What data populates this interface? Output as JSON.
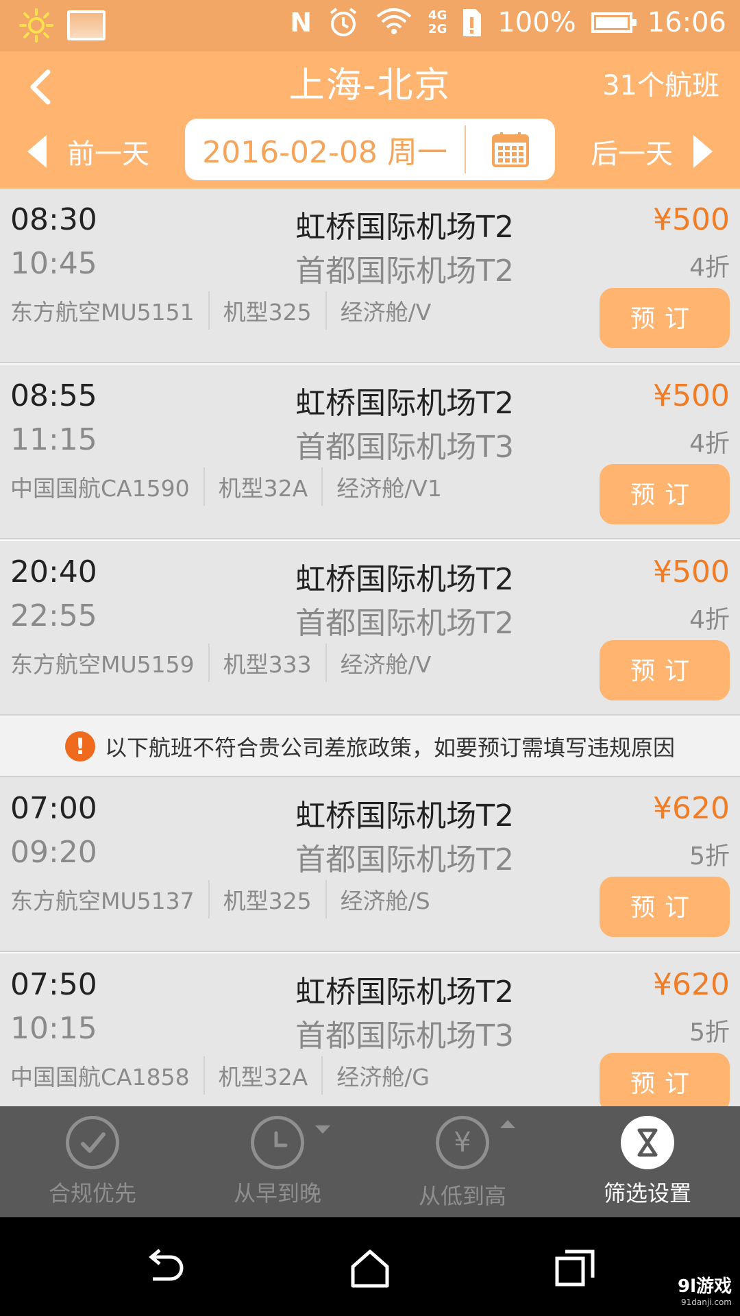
{
  "status_bar": {
    "icons": [
      "sun-icon",
      "image-icon",
      "nfc-icon",
      "alarm-icon",
      "wifi-icon",
      "signal-icon",
      "sim-icon",
      "battery-icon"
    ],
    "network_4g": "4G",
    "network_2g": "2G",
    "battery_percent": "100%",
    "time": "16:06"
  },
  "header": {
    "title": "上海-北京",
    "flight_count": "31个航班",
    "prev_day": "前一天",
    "next_day": "后一天",
    "date": "2016-02-08 周一",
    "accent_color": "#ffb470"
  },
  "flights_compliant": [
    {
      "dep_time": "08:30",
      "arr_time": "10:45",
      "dep_airport": "虹桥国际机场T2",
      "arr_airport": "首都国际机场T2",
      "price": "¥500",
      "discount": "4折",
      "airline": "东方航空MU5151",
      "aircraft": "机型325",
      "cabin": "经济舱/V",
      "book": "预订"
    },
    {
      "dep_time": "08:55",
      "arr_time": "11:15",
      "dep_airport": "虹桥国际机场T2",
      "arr_airport": "首都国际机场T3",
      "price": "¥500",
      "discount": "4折",
      "airline": "中国国航CA1590",
      "aircraft": "机型32A",
      "cabin": "经济舱/V1",
      "book": "预订"
    },
    {
      "dep_time": "20:40",
      "arr_time": "22:55",
      "dep_airport": "虹桥国际机场T2",
      "arr_airport": "首都国际机场T2",
      "price": "¥500",
      "discount": "4折",
      "airline": "东方航空MU5159",
      "aircraft": "机型333",
      "cabin": "经济舱/V",
      "book": "预订"
    }
  ],
  "notice": "以下航班不符合贵公司差旅政策，如要预订需填写违规原因",
  "flights_noncompliant": [
    {
      "dep_time": "07:00",
      "arr_time": "09:20",
      "dep_airport": "虹桥国际机场T2",
      "arr_airport": "首都国际机场T2",
      "price": "¥620",
      "discount": "5折",
      "airline": "东方航空MU5137",
      "aircraft": "机型325",
      "cabin": "经济舱/S",
      "book": "预订"
    },
    {
      "dep_time": "07:50",
      "arr_time": "10:15",
      "dep_airport": "虹桥国际机场T2",
      "arr_airport": "首都国际机场T3",
      "price": "¥620",
      "discount": "5折",
      "airline": "中国国航CA1858",
      "aircraft": "机型32A",
      "cabin": "经济舱/G",
      "book": "预订"
    }
  ],
  "toolbar": {
    "items": [
      {
        "label": "合规优先",
        "icon": "check-circle-icon"
      },
      {
        "label": "从早到晚",
        "icon": "clock-icon"
      },
      {
        "label": "从低到高",
        "icon": "yen-circle-icon"
      },
      {
        "label": "筛选设置",
        "icon": "hourglass-icon"
      }
    ]
  },
  "watermark": {
    "brand": "9l游戏",
    "site": "91danji.com"
  },
  "colors": {
    "price": "#f07d25",
    "status_bar": "#f2a766",
    "toolbar": "#595959",
    "warning": "#ef6a1c"
  }
}
